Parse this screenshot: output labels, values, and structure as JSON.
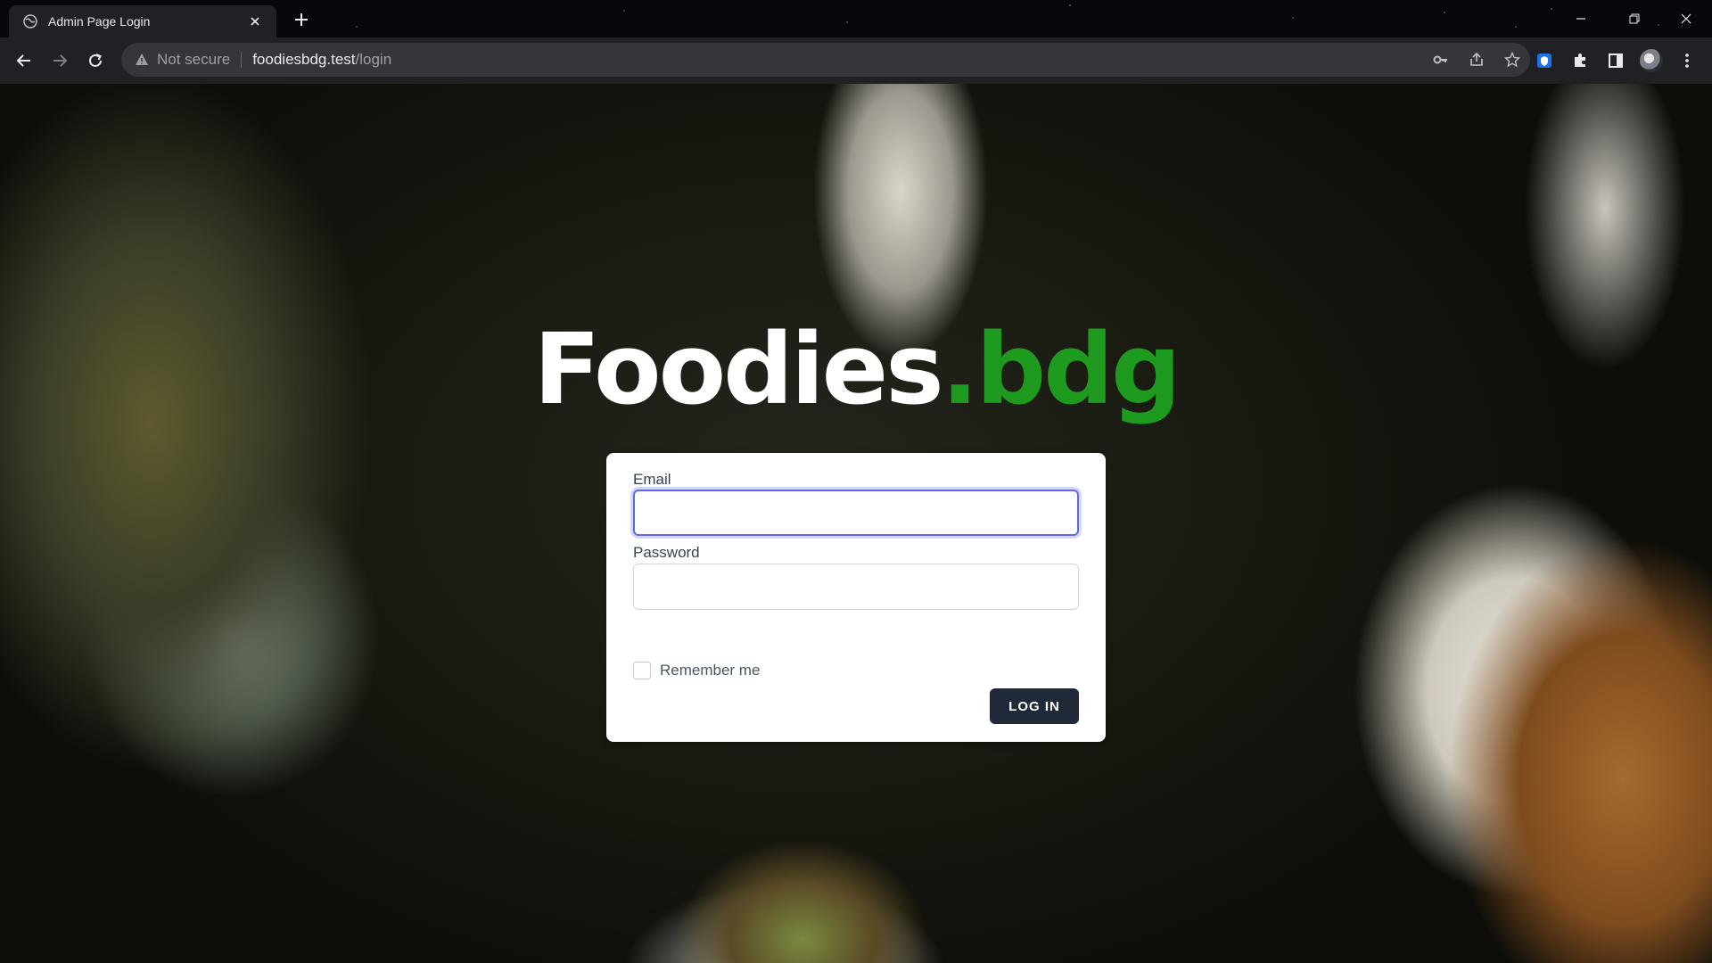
{
  "browser": {
    "tab": {
      "title": "Admin Page Login",
      "favicon": "globe-icon"
    },
    "address": {
      "security_label": "Not secure",
      "host": "foodiesbdg.test",
      "path": "/login"
    }
  },
  "page": {
    "brand": {
      "name": "Foodies",
      "suffix": ".bdg"
    },
    "form": {
      "email": {
        "label": "Email",
        "value": ""
      },
      "password": {
        "label": "Password",
        "value": ""
      },
      "remember_label": "Remember me",
      "submit_label": "LOG IN"
    }
  },
  "colors": {
    "brand_accent": "#1e9b1e",
    "button_bg": "#1f2937",
    "focus_ring": "#6366f1"
  }
}
